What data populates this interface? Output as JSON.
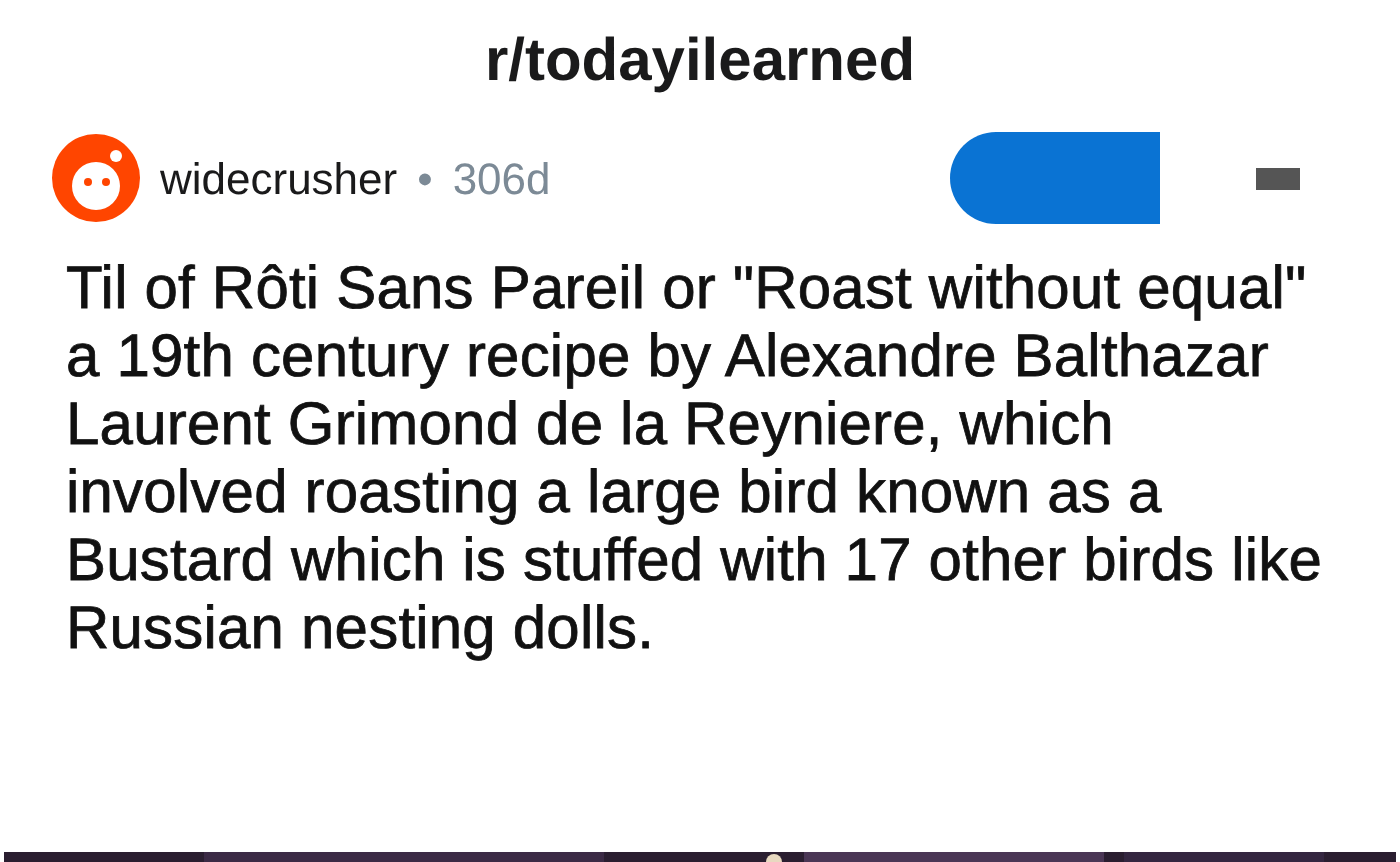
{
  "header": {
    "title": "r/todayilearned"
  },
  "post": {
    "author": "widecrusher",
    "separator": "•",
    "age": "306d",
    "title": "Til of Rôti Sans Pareil or \"Roast without equal\" a 19th century recipe by Alexandre Balthazar Laurent Grimond de la Reyniere, which involved roasting a large bird known as a Bustard which is stuffed with 17 other birds like Russian nesting dolls."
  }
}
